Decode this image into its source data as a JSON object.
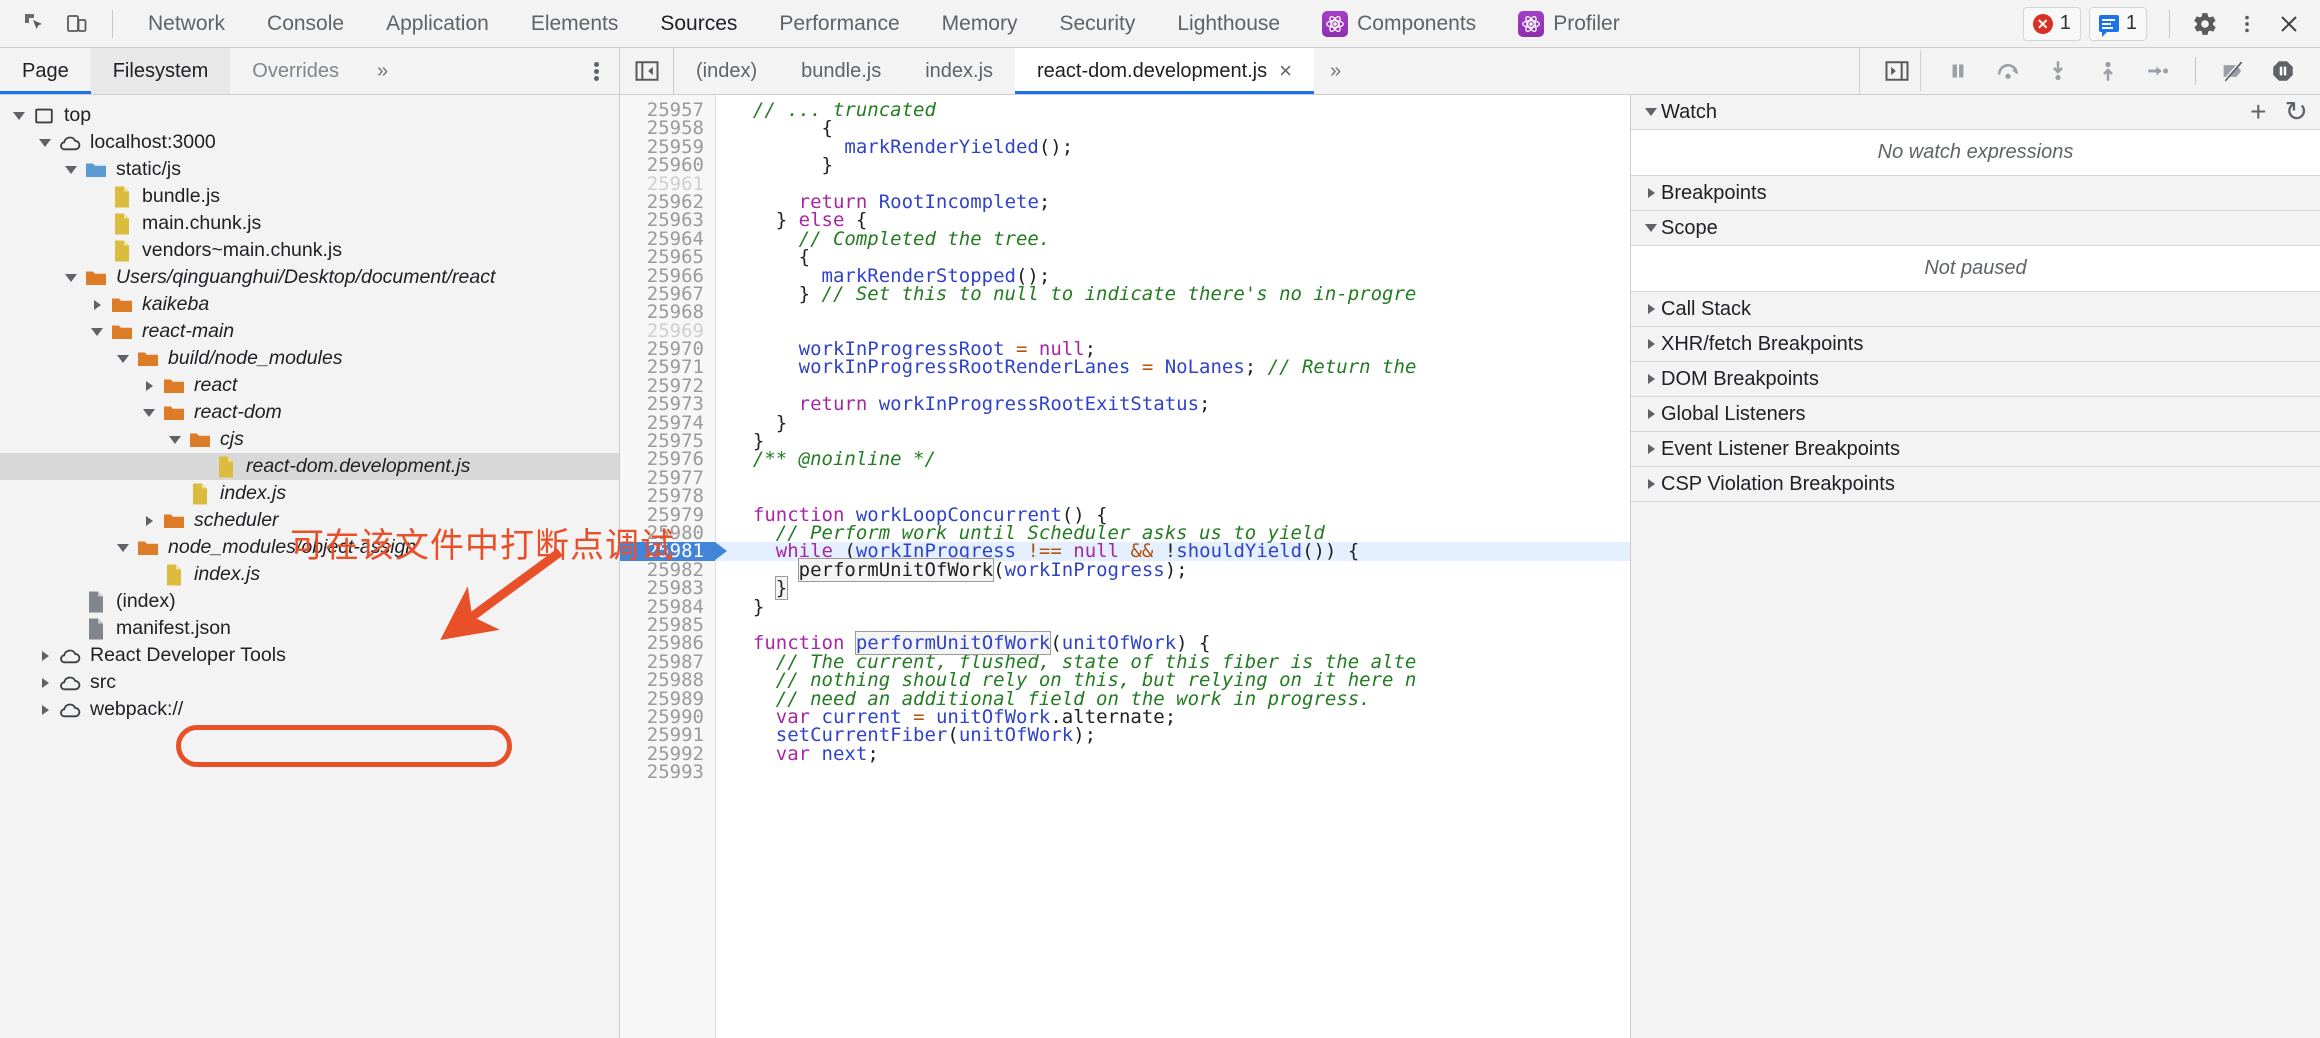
{
  "toolbar": {
    "icons": [
      {
        "name": "inspect-element-icon"
      },
      {
        "name": "device-toolbar-icon"
      }
    ],
    "panels": [
      {
        "label": "Network",
        "active": false,
        "react": false
      },
      {
        "label": "Console",
        "active": false,
        "react": false
      },
      {
        "label": "Application",
        "active": false,
        "react": false
      },
      {
        "label": "Elements",
        "active": false,
        "react": false
      },
      {
        "label": "Sources",
        "active": true,
        "react": false
      },
      {
        "label": "Performance",
        "active": false,
        "react": false
      },
      {
        "label": "Memory",
        "active": false,
        "react": false
      },
      {
        "label": "Security",
        "active": false,
        "react": false
      },
      {
        "label": "Lighthouse",
        "active": false,
        "react": false
      },
      {
        "label": "Components",
        "active": false,
        "react": true
      },
      {
        "label": "Profiler",
        "active": false,
        "react": true
      }
    ],
    "error_count": "1",
    "message_count": "1",
    "settings_label": "gear-icon",
    "more_label": "kebab-icon",
    "close_label": "×"
  },
  "navigator_tabs": {
    "tabs": [
      {
        "label": "Page",
        "active": true,
        "hovered": false,
        "muted": false
      },
      {
        "label": "Filesystem",
        "active": false,
        "hovered": true,
        "muted": false
      },
      {
        "label": "Overrides",
        "active": false,
        "hovered": false,
        "muted": true
      }
    ],
    "more_chevron": "»"
  },
  "file_tabs": {
    "tabs": [
      {
        "label": "(index)",
        "active": false,
        "closable": false
      },
      {
        "label": "bundle.js",
        "active": false,
        "closable": false
      },
      {
        "label": "index.js",
        "active": false,
        "closable": false
      },
      {
        "label": "react-dom.development.js",
        "active": true,
        "closable": true
      }
    ],
    "close_glyph": "×",
    "more_chevron": "»"
  },
  "debugger_controls": [
    {
      "name": "pause-script-execution-button"
    },
    {
      "name": "step-over-next-function-call-button"
    },
    {
      "name": "step-into-next-function-call-button"
    },
    {
      "name": "step-out-of-current-function-button"
    },
    {
      "name": "step-button"
    },
    {
      "name": "deactivate-breakpoints-button"
    },
    {
      "name": "pause-on-exceptions-button"
    }
  ],
  "file_tree": [
    {
      "label": "top",
      "depth": 0,
      "icon": "frame",
      "twisty": "open",
      "italic": false,
      "selected": false
    },
    {
      "label": "localhost:3000",
      "depth": 1,
      "icon": "cloud",
      "twisty": "open",
      "italic": false,
      "selected": false
    },
    {
      "label": "static/js",
      "depth": 2,
      "icon": "folder-blue",
      "twisty": "open",
      "italic": false,
      "selected": false
    },
    {
      "label": "bundle.js",
      "depth": 3,
      "icon": "file-js",
      "twisty": "none",
      "italic": false,
      "selected": false
    },
    {
      "label": "main.chunk.js",
      "depth": 3,
      "icon": "file-js",
      "twisty": "none",
      "italic": false,
      "selected": false
    },
    {
      "label": "vendors~main.chunk.js",
      "depth": 3,
      "icon": "file-js",
      "twisty": "none",
      "italic": false,
      "selected": false
    },
    {
      "label": "Users/qinguanghui/Desktop/document/react",
      "depth": 2,
      "icon": "folder-orange",
      "twisty": "open",
      "italic": true,
      "selected": false
    },
    {
      "label": "kaikeba",
      "depth": 3,
      "icon": "folder-orange",
      "twisty": "closed",
      "italic": true,
      "selected": false
    },
    {
      "label": "react-main",
      "depth": 3,
      "icon": "folder-orange",
      "twisty": "open",
      "italic": true,
      "selected": false
    },
    {
      "label": "build/node_modules",
      "depth": 4,
      "icon": "folder-orange",
      "twisty": "open",
      "italic": true,
      "selected": false
    },
    {
      "label": "react",
      "depth": 5,
      "icon": "folder-orange",
      "twisty": "closed",
      "italic": true,
      "selected": false
    },
    {
      "label": "react-dom",
      "depth": 5,
      "icon": "folder-orange",
      "twisty": "open",
      "italic": true,
      "selected": false
    },
    {
      "label": "cjs",
      "depth": 6,
      "icon": "folder-orange",
      "twisty": "open",
      "italic": true,
      "selected": false
    },
    {
      "label": "react-dom.development.js",
      "depth": 7,
      "icon": "file-js",
      "twisty": "none",
      "italic": true,
      "selected": true
    },
    {
      "label": "index.js",
      "depth": 6,
      "icon": "file-js",
      "twisty": "none",
      "italic": true,
      "selected": false
    },
    {
      "label": "scheduler",
      "depth": 5,
      "icon": "folder-orange",
      "twisty": "closed",
      "italic": true,
      "selected": false
    },
    {
      "label": "node_modules/object-assign",
      "depth": 4,
      "icon": "folder-orange",
      "twisty": "open",
      "italic": true,
      "selected": false
    },
    {
      "label": "index.js",
      "depth": 5,
      "icon": "file-js",
      "twisty": "none",
      "italic": true,
      "selected": false
    },
    {
      "label": "(index)",
      "depth": 2,
      "icon": "file-gray",
      "twisty": "none",
      "italic": false,
      "selected": false
    },
    {
      "label": "manifest.json",
      "depth": 2,
      "icon": "file-gray",
      "twisty": "none",
      "italic": false,
      "selected": false
    },
    {
      "label": "React Developer Tools",
      "depth": 1,
      "icon": "cloud",
      "twisty": "closed",
      "italic": false,
      "selected": false
    },
    {
      "label": "src",
      "depth": 1,
      "icon": "cloud",
      "twisty": "closed",
      "italic": false,
      "selected": false
    },
    {
      "label": "webpack://",
      "depth": 1,
      "icon": "cloud",
      "twisty": "closed",
      "italic": false,
      "selected": false
    }
  ],
  "editor": {
    "first_line": 25957,
    "current_line": 25981,
    "lines": [
      {
        "n": 25957,
        "tokens": [
          {
            "t": "  ",
            "c": "pl"
          },
          {
            "t": "// ... truncated",
            "c": "cm"
          }
        ],
        "clipped_top": true
      },
      {
        "n": 25958,
        "tokens": [
          {
            "t": "        {",
            "c": "pl"
          }
        ]
      },
      {
        "n": 25959,
        "tokens": [
          {
            "t": "          ",
            "c": "pl"
          },
          {
            "t": "markRenderYielded",
            "c": "fn"
          },
          {
            "t": "();",
            "c": "pl"
          }
        ]
      },
      {
        "n": 25960,
        "tokens": [
          {
            "t": "        }",
            "c": "pl"
          }
        ]
      },
      {
        "n": 25961,
        "tokens": [],
        "blank": true
      },
      {
        "n": 25962,
        "tokens": [
          {
            "t": "      ",
            "c": "pl"
          },
          {
            "t": "return",
            "c": "kw"
          },
          {
            "t": " ",
            "c": "pl"
          },
          {
            "t": "RootIncomplete",
            "c": "fn"
          },
          {
            "t": ";",
            "c": "pl"
          }
        ]
      },
      {
        "n": 25963,
        "tokens": [
          {
            "t": "    } ",
            "c": "pl"
          },
          {
            "t": "else",
            "c": "kw"
          },
          {
            "t": " {",
            "c": "pl"
          }
        ]
      },
      {
        "n": 25964,
        "tokens": [
          {
            "t": "      ",
            "c": "pl"
          },
          {
            "t": "// Completed the tree.",
            "c": "cm"
          }
        ]
      },
      {
        "n": 25965,
        "tokens": [
          {
            "t": "      {",
            "c": "pl"
          }
        ]
      },
      {
        "n": 25966,
        "tokens": [
          {
            "t": "        ",
            "c": "pl"
          },
          {
            "t": "markRenderStopped",
            "c": "fn"
          },
          {
            "t": "();",
            "c": "pl"
          }
        ]
      },
      {
        "n": 25967,
        "tokens": [
          {
            "t": "      } ",
            "c": "pl"
          },
          {
            "t": "// Set this to null to indicate there's no in-progre",
            "c": "cm"
          }
        ]
      },
      {
        "n": 25968,
        "tokens": []
      },
      {
        "n": 25969,
        "tokens": [],
        "blank": true
      },
      {
        "n": 25970,
        "tokens": [
          {
            "t": "      ",
            "c": "pl"
          },
          {
            "t": "workInProgressRoot",
            "c": "vr"
          },
          {
            "t": " = ",
            "c": "op"
          },
          {
            "t": "null",
            "c": "kw"
          },
          {
            "t": ";",
            "c": "pl"
          }
        ]
      },
      {
        "n": 25971,
        "tokens": [
          {
            "t": "      ",
            "c": "pl"
          },
          {
            "t": "workInProgressRootRenderLanes",
            "c": "vr"
          },
          {
            "t": " = ",
            "c": "op"
          },
          {
            "t": "NoLanes",
            "c": "vr"
          },
          {
            "t": "; ",
            "c": "pl"
          },
          {
            "t": "// Return the",
            "c": "cm"
          }
        ]
      },
      {
        "n": 25972,
        "tokens": []
      },
      {
        "n": 25973,
        "tokens": [
          {
            "t": "      ",
            "c": "pl"
          },
          {
            "t": "return",
            "c": "kw"
          },
          {
            "t": " ",
            "c": "pl"
          },
          {
            "t": "workInProgressRootExitStatus",
            "c": "vr"
          },
          {
            "t": ";",
            "c": "pl"
          }
        ]
      },
      {
        "n": 25974,
        "tokens": [
          {
            "t": "    }",
            "c": "pl"
          }
        ]
      },
      {
        "n": 25975,
        "tokens": [
          {
            "t": "  }",
            "c": "pl"
          }
        ]
      },
      {
        "n": 25976,
        "tokens": [
          {
            "t": "  ",
            "c": "pl"
          },
          {
            "t": "/** @noinline */",
            "c": "cm"
          }
        ]
      },
      {
        "n": 25977,
        "tokens": []
      },
      {
        "n": 25978,
        "tokens": []
      },
      {
        "n": 25979,
        "tokens": [
          {
            "t": "  ",
            "c": "pl"
          },
          {
            "t": "function",
            "c": "kw"
          },
          {
            "t": " ",
            "c": "pl"
          },
          {
            "t": "workLoopConcurrent",
            "c": "fn"
          },
          {
            "t": "() {",
            "c": "pl"
          }
        ]
      },
      {
        "n": 25980,
        "tokens": [
          {
            "t": "    ",
            "c": "pl"
          },
          {
            "t": "// Perform work until Scheduler asks us to yield",
            "c": "cm"
          }
        ]
      },
      {
        "n": 25981,
        "current": true,
        "tokens": [
          {
            "t": "    ",
            "c": "pl"
          },
          {
            "t": "while",
            "c": "kw"
          },
          {
            "t": " (",
            "c": "pl"
          },
          {
            "t": "workInProgress",
            "c": "vr"
          },
          {
            "t": " ",
            "c": "pl"
          },
          {
            "t": "!==",
            "c": "op"
          },
          {
            "t": " ",
            "c": "pl"
          },
          {
            "t": "null",
            "c": "kw"
          },
          {
            "t": " ",
            "c": "pl"
          },
          {
            "t": "&&",
            "c": "op"
          },
          {
            "t": " !",
            "c": "pl"
          },
          {
            "t": "shouldYield",
            "c": "fn"
          },
          {
            "t": "()) {",
            "c": "pl"
          }
        ]
      },
      {
        "n": 25982,
        "tokens": [
          {
            "t": "      ",
            "c": "pl"
          },
          {
            "t": "performUnitOfWork",
            "c": "pl",
            "box": true
          },
          {
            "t": "(",
            "c": "pl"
          },
          {
            "t": "workInProgress",
            "c": "vr"
          },
          {
            "t": ");",
            "c": "pl"
          }
        ]
      },
      {
        "n": 25983,
        "tokens": [
          {
            "t": "    ",
            "c": "pl"
          },
          {
            "t": "}",
            "c": "pl",
            "box": true
          }
        ]
      },
      {
        "n": 25984,
        "tokens": [
          {
            "t": "  }",
            "c": "pl"
          }
        ]
      },
      {
        "n": 25985,
        "tokens": []
      },
      {
        "n": 25986,
        "tokens": [
          {
            "t": "  ",
            "c": "pl"
          },
          {
            "t": "function",
            "c": "kw"
          },
          {
            "t": " ",
            "c": "pl"
          },
          {
            "t": "performUnitOfWork",
            "c": "fn",
            "box": true
          },
          {
            "t": "(",
            "c": "pl"
          },
          {
            "t": "unitOfWork",
            "c": "vr"
          },
          {
            "t": ") {",
            "c": "pl"
          }
        ]
      },
      {
        "n": 25987,
        "tokens": [
          {
            "t": "    ",
            "c": "pl"
          },
          {
            "t": "// The current, flushed, state of this fiber is the alte",
            "c": "cm"
          }
        ]
      },
      {
        "n": 25988,
        "tokens": [
          {
            "t": "    ",
            "c": "pl"
          },
          {
            "t": "// nothing should rely on this, but relying on it here n",
            "c": "cm"
          }
        ]
      },
      {
        "n": 25989,
        "tokens": [
          {
            "t": "    ",
            "c": "pl"
          },
          {
            "t": "// need an additional field on the work in progress.",
            "c": "cm"
          }
        ]
      },
      {
        "n": 25990,
        "tokens": [
          {
            "t": "    ",
            "c": "pl"
          },
          {
            "t": "var",
            "c": "kw"
          },
          {
            "t": " ",
            "c": "pl"
          },
          {
            "t": "current",
            "c": "vr"
          },
          {
            "t": " = ",
            "c": "op"
          },
          {
            "t": "unitOfWork",
            "c": "vr"
          },
          {
            "t": ".alternate;",
            "c": "pl"
          }
        ]
      },
      {
        "n": 25991,
        "tokens": [
          {
            "t": "    ",
            "c": "pl"
          },
          {
            "t": "setCurrentFiber",
            "c": "fn"
          },
          {
            "t": "(",
            "c": "pl"
          },
          {
            "t": "unitOfWork",
            "c": "vr"
          },
          {
            "t": ");",
            "c": "pl"
          }
        ]
      },
      {
        "n": 25992,
        "tokens": [
          {
            "t": "    ",
            "c": "pl"
          },
          {
            "t": "var",
            "c": "kw"
          },
          {
            "t": " ",
            "c": "pl"
          },
          {
            "t": "next",
            "c": "vr"
          },
          {
            "t": ";",
            "c": "pl"
          }
        ]
      },
      {
        "n": 25993,
        "tokens": [],
        "clipped_bottom": true
      }
    ]
  },
  "debugger_panel": {
    "sections": [
      {
        "title": "Watch",
        "expanded": true,
        "empty_text": "No watch expressions",
        "has_actions": true
      },
      {
        "title": "Breakpoints",
        "expanded": false,
        "empty_text": null,
        "has_actions": false
      },
      {
        "title": "Scope",
        "expanded": true,
        "empty_text": "Not paused",
        "has_actions": false
      },
      {
        "title": "Call Stack",
        "expanded": false,
        "empty_text": null,
        "has_actions": false
      },
      {
        "title": "XHR/fetch Breakpoints",
        "expanded": false,
        "empty_text": null,
        "has_actions": false
      },
      {
        "title": "DOM Breakpoints",
        "expanded": false,
        "empty_text": null,
        "has_actions": false
      },
      {
        "title": "Global Listeners",
        "expanded": false,
        "empty_text": null,
        "has_actions": false
      },
      {
        "title": "Event Listener Breakpoints",
        "expanded": false,
        "empty_text": null,
        "has_actions": false
      },
      {
        "title": "CSP Violation Breakpoints",
        "expanded": false,
        "empty_text": null,
        "has_actions": false
      }
    ],
    "add_label": "+",
    "refresh_label": "↻"
  },
  "annotations": {
    "note_text": "可在该文件中打断点调试",
    "color": "#e8502a"
  }
}
